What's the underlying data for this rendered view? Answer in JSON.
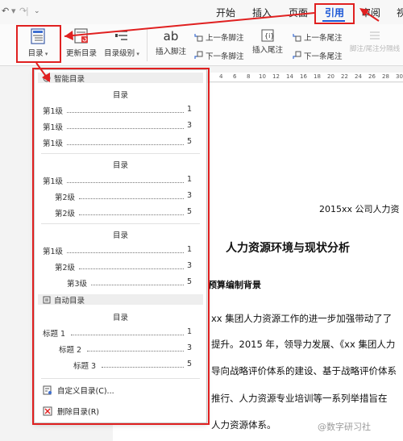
{
  "quick_access": {
    "undo": "↶",
    "undo_arrow": "▾",
    "redo": "↷",
    "separator": "|",
    "more": "⌄"
  },
  "tabs": [
    {
      "label": "开始"
    },
    {
      "label": "插入"
    },
    {
      "label": "页面"
    },
    {
      "label": "引用"
    },
    {
      "label": "审阅"
    },
    {
      "label": "视"
    }
  ],
  "ribbon": {
    "toc_label": "目录",
    "update_toc": "更新目录",
    "toc_level": "目录级别",
    "insert_footnote_icon": "ab",
    "insert_footnote": "插入脚注",
    "prev_footnote": "上一条脚注",
    "next_footnote": "下一条脚注",
    "insert_endnote": "插入尾注",
    "prev_endnote": "上一条尾注",
    "next_endnote": "下一条尾注",
    "footnote_separator": "脚注/尾注分隔线"
  },
  "ruler": [
    "4",
    "6",
    "8",
    "10",
    "12",
    "14",
    "16",
    "18",
    "20",
    "22",
    "24",
    "26",
    "28",
    "30"
  ],
  "panel": {
    "smart_toc": "智能目录",
    "preset_heading": "目录",
    "preset1": [
      {
        "label": "第1级",
        "page": "1"
      },
      {
        "label": "第1级",
        "page": "3"
      },
      {
        "label": "第1级",
        "page": "5"
      }
    ],
    "preset2": [
      {
        "label": "第1级",
        "page": "1"
      },
      {
        "label": "第2级",
        "page": "3"
      },
      {
        "label": "第2级",
        "page": "5"
      }
    ],
    "preset3": [
      {
        "label": "第1级",
        "page": "1"
      },
      {
        "label": "第2级",
        "page": "3"
      },
      {
        "label": "第3级",
        "page": "5"
      }
    ],
    "auto_toc": "自动目录",
    "auto_items": [
      {
        "label": "标题 1",
        "page": "1"
      },
      {
        "label": "标题 2",
        "page": "3"
      },
      {
        "label": "标题 3",
        "page": "5"
      }
    ],
    "custom_toc": "自定义目录(C)...",
    "delete_toc": "删除目录(R)"
  },
  "document": {
    "header": "2015xx 公司人力资",
    "section_num": "、",
    "section_title": "人力资源环境与现状分析",
    "subheading": "预算编制背景",
    "para_lines": [
      "xx 集团人力资源工作的进一步加强带动了了",
      "提升。2015 年，领导力发展、《xx 集团人力",
      "导向战略评价体系的建设、基于战略评价体系",
      "推行、人力资源专业培训等一系列举措旨在",
      "人力资源体系。"
    ]
  },
  "watermark": "@数字研习社",
  "colors": {
    "accent": "#1a56d6",
    "annotation_red": "#e02020"
  }
}
